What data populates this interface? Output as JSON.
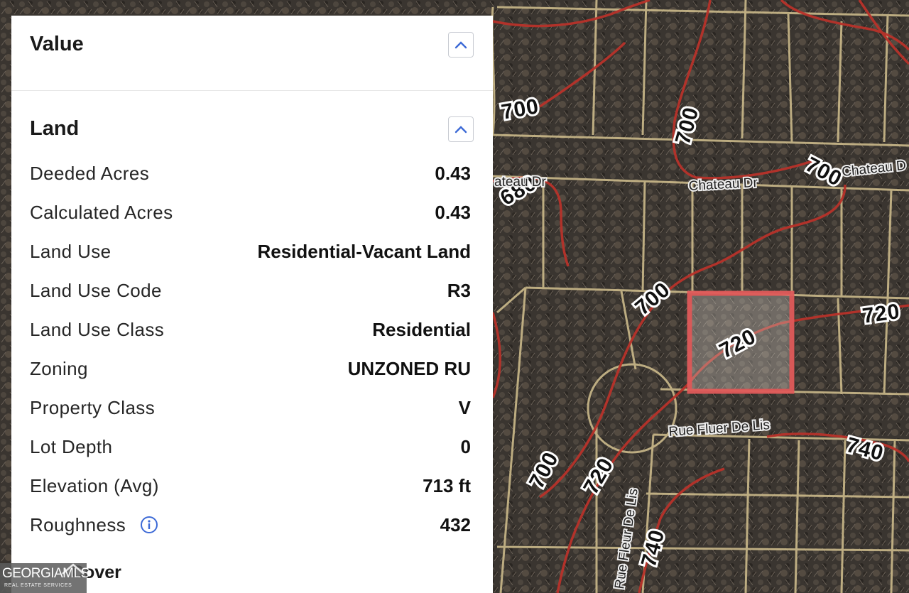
{
  "panel": {
    "value_section": {
      "title": "Value"
    },
    "land_section": {
      "title": "Land",
      "rows": [
        {
          "label": "Deeded Acres",
          "value": "0.43"
        },
        {
          "label": "Calculated Acres",
          "value": "0.43"
        },
        {
          "label": "Land Use",
          "value": "Residential-Vacant Land"
        },
        {
          "label": "Land Use Code",
          "value": "R3"
        },
        {
          "label": "Land Use Class",
          "value": "Residential"
        },
        {
          "label": "Zoning",
          "value": "UNZONED RU"
        },
        {
          "label": "Property Class",
          "value": "V"
        },
        {
          "label": "Lot Depth",
          "value": "0"
        },
        {
          "label": "Elevation (Avg)",
          "value": "713 ft"
        },
        {
          "label": "Roughness",
          "value": "432"
        }
      ],
      "next_section_partial": "Cover"
    }
  },
  "map": {
    "contour_labels": [
      "700",
      "700",
      "700",
      "680",
      "700",
      "720",
      "720",
      "720",
      "700",
      "740",
      "740"
    ],
    "street_labels": [
      "Chateau Dr",
      "Chateau D",
      "Rue Fluer De Lis",
      "Rue Fleur De Lis",
      "ateau Dr"
    ],
    "colors": {
      "contour": "#c0392b",
      "parcel_line": "#cbb98a",
      "selected_parcel": "#e05a5a"
    }
  },
  "logo": {
    "text": "GEORGIAMLS",
    "subtext": "REAL ESTATE SERVICES"
  },
  "icons": {
    "collapse": "chevron-up-icon",
    "info": "info-icon"
  }
}
